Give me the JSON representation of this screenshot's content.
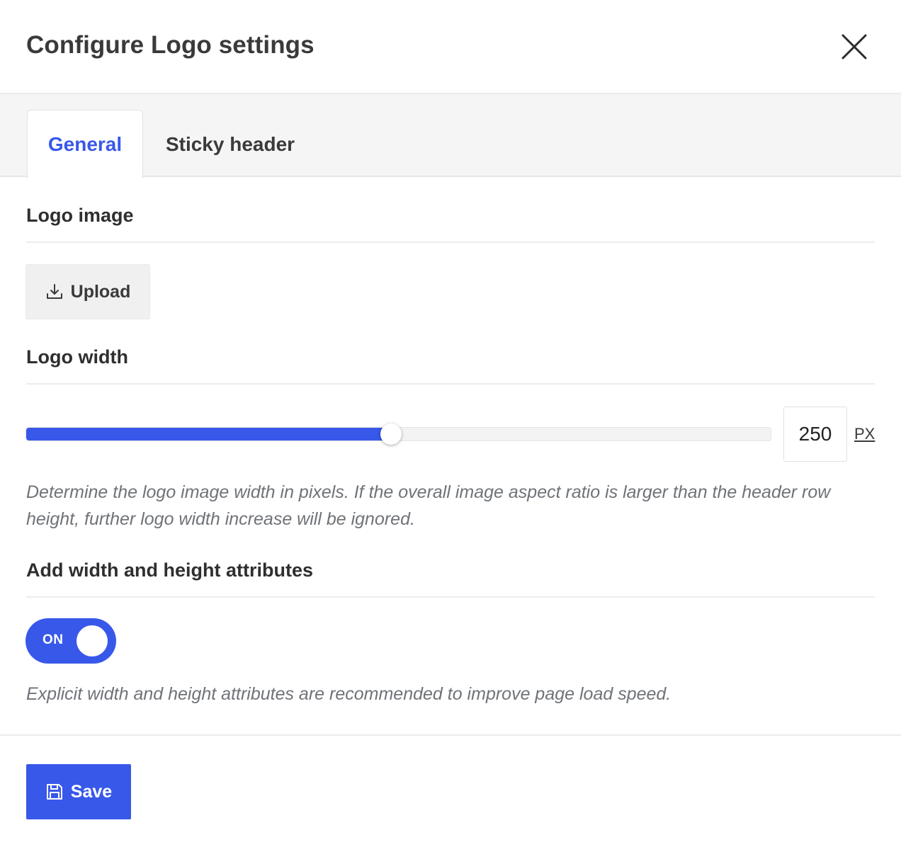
{
  "dialog": {
    "title": "Configure Logo settings",
    "close_icon": "close-icon"
  },
  "tabs": [
    {
      "label": "General",
      "active": true
    },
    {
      "label": "Sticky header",
      "active": false
    }
  ],
  "logo_image": {
    "heading": "Logo image",
    "upload_label": "Upload",
    "upload_icon": "download-icon"
  },
  "logo_width": {
    "heading": "Logo width",
    "value": "250",
    "unit": "PX",
    "slider_fraction": 0.49,
    "help": "Determine the logo image width in pixels. If the overall image aspect ratio is larger than the header row height, further logo width increase will be ignored."
  },
  "attributes": {
    "heading": "Add width and height attributes",
    "toggle_label": "ON",
    "toggle_on": true,
    "help": "Explicit width and height attributes are recommended to improve page load speed."
  },
  "footer": {
    "save_label": "Save",
    "save_icon": "floppy-disk-icon"
  },
  "colors": {
    "accent": "#3858e9",
    "text": "#3a3a3a",
    "muted": "#6f7378",
    "tab_bar": "#f5f5f5"
  }
}
